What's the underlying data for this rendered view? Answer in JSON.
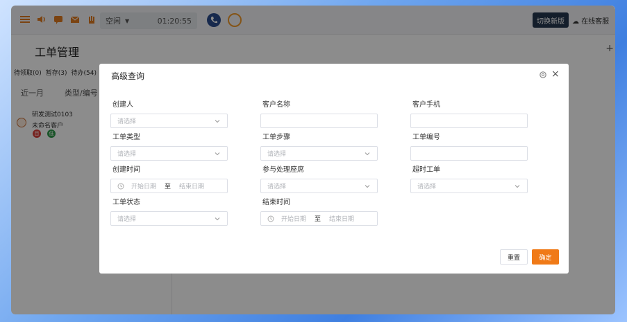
{
  "topbar": {
    "status": "空闲",
    "timer": "01:20:55",
    "new_version": "切换新版",
    "online_service": "在线客服"
  },
  "page": {
    "title": "工单管理",
    "tabs": [
      "待领取(0)",
      "暂存(3)",
      "待办(54)"
    ],
    "filter_period": "近一月",
    "filter_type": "类型/编号",
    "ticket": {
      "title": "研发测试0103",
      "customer": "未命名客户",
      "tag_red": "目",
      "tag_green": "低"
    }
  },
  "modal": {
    "title": "高级查询",
    "fields": {
      "creator": {
        "label": "创建人",
        "placeholder": "请选择"
      },
      "customer_name": {
        "label": "客户名称",
        "placeholder": ""
      },
      "customer_phone": {
        "label": "客户手机",
        "placeholder": ""
      },
      "ticket_type": {
        "label": "工单类型",
        "placeholder": "请选择"
      },
      "ticket_step": {
        "label": "工单步骤",
        "placeholder": "请选择"
      },
      "ticket_number": {
        "label": "工单编号",
        "placeholder": ""
      },
      "create_time": {
        "label": "创建时间",
        "start": "开始日期",
        "sep": "至",
        "end": "结束日期"
      },
      "handling_seat": {
        "label": "参与处理座席",
        "placeholder": "请选择"
      },
      "overdue_ticket": {
        "label": "超时工单",
        "placeholder": "请选择"
      },
      "ticket_status": {
        "label": "工单状态",
        "placeholder": "请选择"
      },
      "end_time": {
        "label": "结束时间",
        "start": "开始日期",
        "sep": "至",
        "end": "结束日期"
      }
    },
    "buttons": {
      "reset": "重置",
      "confirm": "确定"
    }
  },
  "colors": {
    "accent": "#f07a17",
    "frame": "#3f7fe0"
  }
}
